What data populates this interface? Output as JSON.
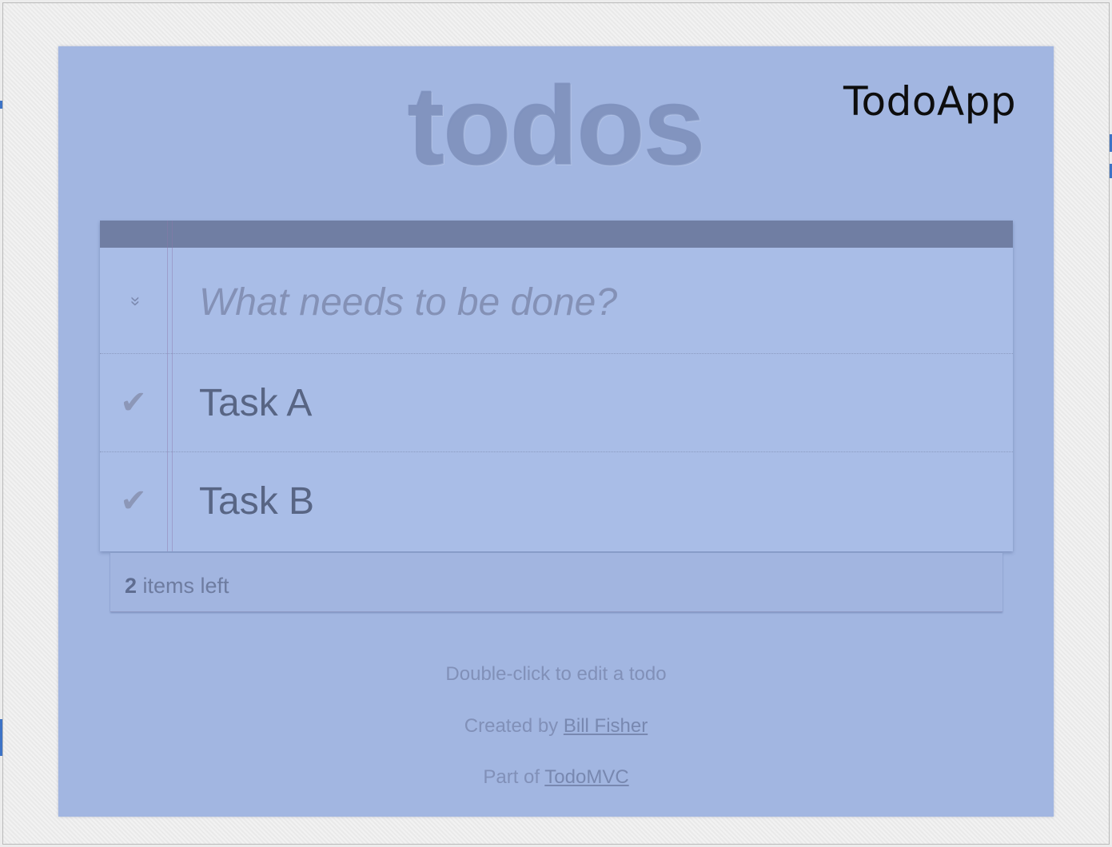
{
  "overlay_label": "TodoApp",
  "app": {
    "title": "todos"
  },
  "new_todo": {
    "placeholder": "What needs to be done?",
    "toggle_all_glyph": "»"
  },
  "todos": [
    {
      "label": "Task A",
      "completed": false,
      "check_glyph": "✔"
    },
    {
      "label": "Task B",
      "completed": false,
      "check_glyph": "✔"
    }
  ],
  "footer": {
    "count": "2",
    "count_suffix": " items left"
  },
  "info": {
    "edit_hint": "Double-click to edit a todo",
    "created_by_prefix": "Created by ",
    "author": "Bill Fisher",
    "part_of_prefix": "Part of ",
    "todomvc": "TodoMVC"
  },
  "colors": {
    "overlay": "#a2b6e1",
    "card": "#a9bde7",
    "header": "#707ea3"
  }
}
